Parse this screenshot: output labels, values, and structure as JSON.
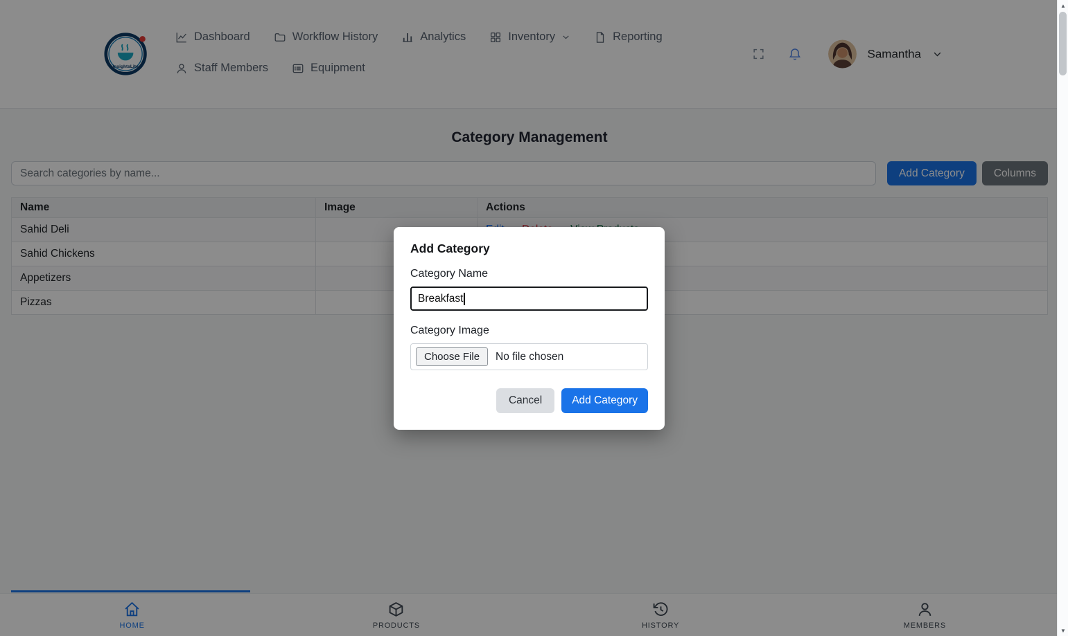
{
  "colors": {
    "accent_blue": "#1a73e8",
    "secondary_gray": "#6c757d",
    "edit_link": "#0d6efd",
    "delete_link": "#dc3545",
    "view_products_link": "#157347"
  },
  "header": {
    "brand": "InsightsLite",
    "nav": [
      {
        "label": "Dashboard",
        "icon": "graph-up-icon"
      },
      {
        "label": "Workflow History",
        "icon": "folder-icon"
      },
      {
        "label": "Analytics",
        "icon": "bar-chart-icon"
      },
      {
        "label": "Inventory",
        "icon": "grid-icon",
        "dropdown": true
      },
      {
        "label": "Reporting",
        "icon": "file-icon"
      },
      {
        "label": "Staff Members",
        "icon": "person-icon"
      },
      {
        "label": "Equipment",
        "icon": "card-list-icon"
      }
    ],
    "user": {
      "name": "Samantha",
      "avatar": "woman-avatar"
    }
  },
  "main": {
    "title": "Category Management",
    "search": {
      "placeholder": "Search categories by name..."
    },
    "buttons": {
      "add_category": "Add Category",
      "columns": "Columns"
    },
    "table": {
      "headers": [
        "Name",
        "Image",
        "Actions"
      ],
      "rows": [
        {
          "name": "Sahid Deli",
          "actions": {
            "edit": "Edit",
            "delete": "Delete",
            "view_products": "View Products"
          }
        },
        {
          "name": "Sahid Chickens"
        },
        {
          "name": "Appetizers"
        },
        {
          "name": "Pizzas"
        }
      ]
    }
  },
  "modal": {
    "title": "Add Category",
    "category_name_label": "Category Name",
    "category_name_value": "Breakfast",
    "category_image_label": "Category Image",
    "file_button_label": "Choose File",
    "file_status": "No file chosen",
    "cancel_label": "Cancel",
    "submit_label": "Add Category"
  },
  "bottom_nav": {
    "items": [
      {
        "label": "HOME",
        "icon": "house-icon",
        "active": true
      },
      {
        "label": "PRODUCTS",
        "icon": "box-icon"
      },
      {
        "label": "HISTORY",
        "icon": "clock-history-icon"
      },
      {
        "label": "MEMBERS",
        "icon": "person-icon"
      }
    ]
  }
}
